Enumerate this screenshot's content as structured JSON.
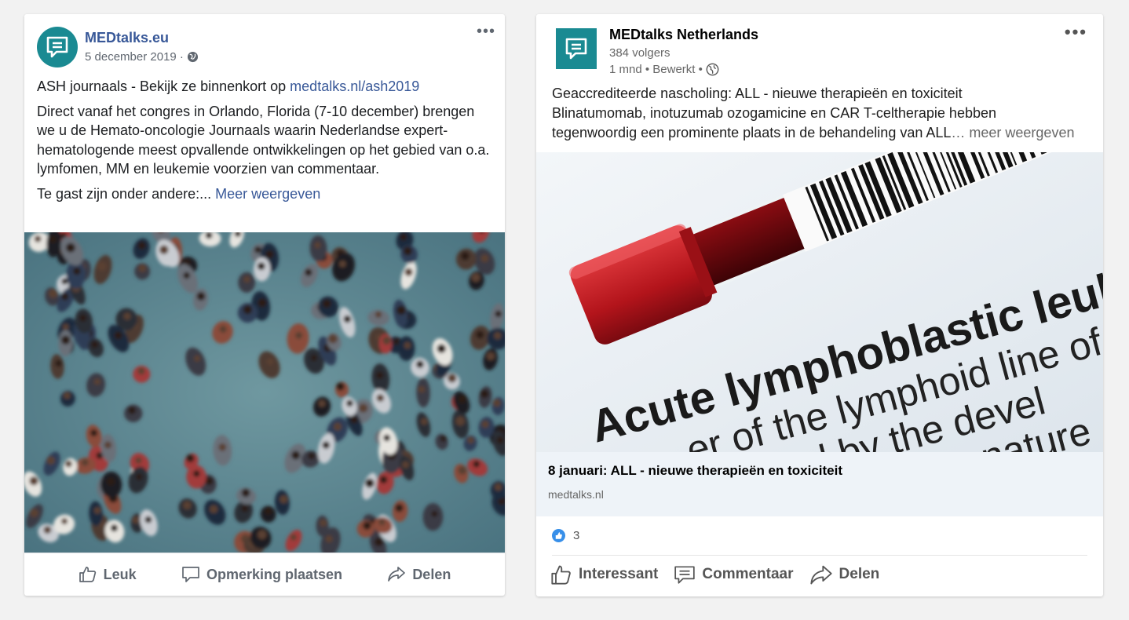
{
  "facebook_post": {
    "page_name": "MEDtalks.eu",
    "date": "5 december 2019 ·",
    "more_icon": "•••",
    "headline_text": "ASH journaals - Bekijk ze binnenkort op ",
    "headline_link": "medtalks.nl/ash2019",
    "body": "Direct vanaf het congres in Orlando, Florida (7-10 december) brengen we u de Hemato-oncologie Journaals waarin Nederlandse expert-hematologende meest opvallende ontwikkelingen op het gebied van o.a. lymfomen, MM en leukemie voorzien van commentaar.",
    "guests_text": "Te gast zijn onder andere:... ",
    "see_more": "Meer weergeven",
    "actions": {
      "like": "Leuk",
      "comment": "Opmerking plaatsen",
      "share": "Delen"
    }
  },
  "linkedin_post": {
    "company_name": "MEDtalks Netherlands",
    "followers": "384 volgers",
    "time_edited": "1 mnd • Bewerkt •",
    "more_icon": "•••",
    "line1": "Geaccrediteerde nascholing: ALL - nieuwe therapieën en toxiciteit",
    "line2": "Blinatumomab, inotuzumab ozogamicine en CAR T-celtherapie hebben",
    "line3": "tegenwoordig een prominente plaats in de behandeling van ALL",
    "see_more": "… meer weergeven",
    "image_text": {
      "title": "Acute lymphoblastic leukemia",
      "line2": "er of the lymphoid line of bl",
      "line3": "ized by the devel",
      "line4": "nature"
    },
    "link_title": "8 januari: ALL - nieuwe therapieën en toxiciteit",
    "link_domain": "medtalks.nl",
    "reaction_count": "3",
    "actions": {
      "interesting": "Interessant",
      "comment": "Commentaar",
      "share": "Delen"
    }
  },
  "colors": {
    "fb_link": "#385898",
    "brand_teal": "#1a8a92",
    "li_like_blue": "#0a66c2",
    "tube_red": "#c01820"
  }
}
